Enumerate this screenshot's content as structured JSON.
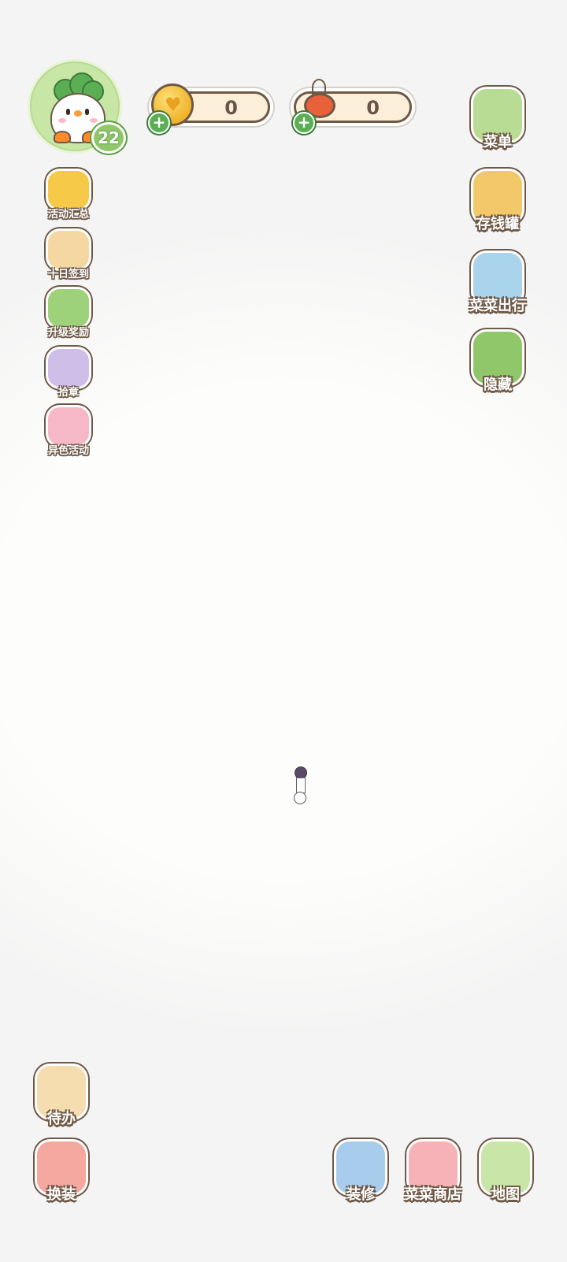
{
  "player": {
    "level": "22"
  },
  "currencies": [
    {
      "name": "coin",
      "amount": "0",
      "icon": "coin-icon"
    },
    {
      "name": "vegetable",
      "amount": "0",
      "icon": "tomato-icon"
    }
  ],
  "left_menu": [
    {
      "label": "活动汇总",
      "icon": "crown-icon",
      "color": "#f7c948"
    },
    {
      "label": "十日签到",
      "icon": "calendar-check-icon",
      "color": "#f5d7a1"
    },
    {
      "label": "升级奖励",
      "icon": "level-up-icon",
      "color": "#9ed27a"
    },
    {
      "label": "拾章",
      "icon": "badge-bag-icon",
      "color": "#cdbfe8"
    },
    {
      "label": "异色活动",
      "icon": "rainbow-icon",
      "color": "#f6b8c6"
    }
  ],
  "right_menu": [
    {
      "label": "菜单",
      "icon": "menu-list-icon",
      "color": "#b8dc94"
    },
    {
      "label": "存钱罐",
      "icon": "piggy-bank-icon",
      "color": "#f3c86a"
    },
    {
      "label": "菜菜出行",
      "icon": "paper-plane-icon",
      "color": "#a9d4ec"
    },
    {
      "label": "隐藏",
      "icon": "hide-frame-icon",
      "color": "#8fc76a"
    }
  ],
  "bottom_left": [
    {
      "label": "待办",
      "icon": "todo-list-icon",
      "color": "#f6ddb0"
    },
    {
      "label": "换装",
      "icon": "wardrobe-icon",
      "color": "#f4a8a0"
    }
  ],
  "bottom_right": [
    {
      "label": "装修",
      "icon": "decorate-trowel-icon",
      "color": "#a8cdec"
    },
    {
      "label": "菜菜商店",
      "icon": "shop-bags-icon",
      "color": "#f7b2b8"
    },
    {
      "label": "地图",
      "icon": "map-pin-icon",
      "color": "#c9e6a8"
    }
  ]
}
